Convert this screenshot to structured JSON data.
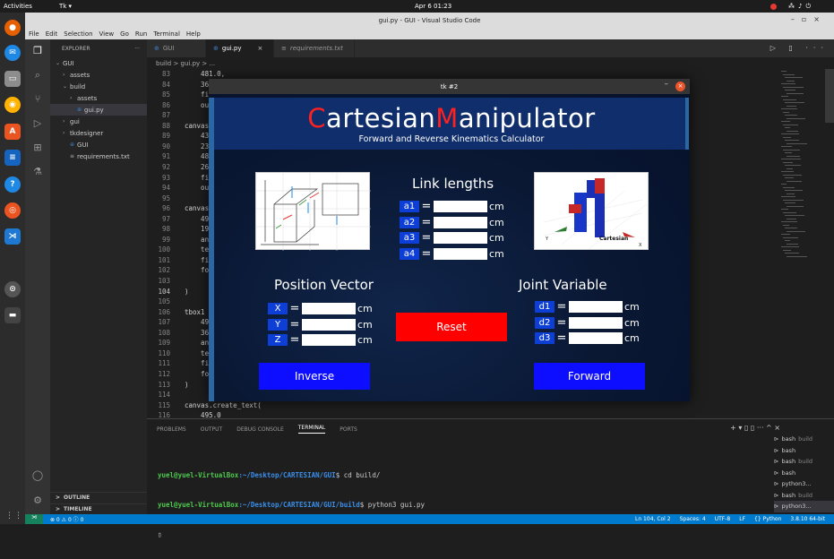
{
  "topbar": {
    "activities": "Activities",
    "app": "Tk ▾",
    "clock": "Apr 6  01:23"
  },
  "vscode": {
    "title": "gui.py - GUI - Visual Studio Code",
    "menu": [
      "File",
      "Edit",
      "Selection",
      "View",
      "Go",
      "Run",
      "Terminal",
      "Help"
    ],
    "explorer": {
      "header": "EXPLORER",
      "more": "···",
      "items": [
        {
          "label": "GUI",
          "arrow": "v",
          "indent": 0
        },
        {
          "label": "assets",
          "arrow": ">",
          "indent": 1
        },
        {
          "label": "build",
          "arrow": "v",
          "indent": 1
        },
        {
          "label": "assets",
          "arrow": ">",
          "indent": 2
        },
        {
          "label": "gui.py",
          "arrow": "",
          "indent": 2,
          "selected": true,
          "py": true
        },
        {
          "label": "gui",
          "arrow": ">",
          "indent": 1
        },
        {
          "label": "tkdesigner",
          "arrow": ">",
          "indent": 1
        },
        {
          "label": "GUI",
          "arrow": "",
          "indent": 1,
          "py": true
        },
        {
          "label": "requirements.txt",
          "arrow": "",
          "indent": 1,
          "txt": true
        }
      ],
      "outline": "OUTLINE",
      "timeline": "TIMELINE"
    },
    "tabs": [
      {
        "label": "GUI",
        "active": false
      },
      {
        "label": "gui.py",
        "active": true,
        "close": "×"
      },
      {
        "label": "requirements.txt",
        "active": false
      }
    ],
    "tab_actions": "▷ ▯ ···",
    "breadcrumb": "build > gui.py > ...",
    "code": [
      {
        "n": "83",
        "t": "    481.0,"
      },
      {
        "n": "84",
        "t": "    36"
      },
      {
        "n": "85",
        "t": "    fi"
      },
      {
        "n": "86",
        "t": "    ou"
      },
      {
        "n": "87",
        "t": ""
      },
      {
        "n": "88",
        "t": "canvas"
      },
      {
        "n": "89",
        "t": "    43"
      },
      {
        "n": "90",
        "t": "    23"
      },
      {
        "n": "91",
        "t": "    48"
      },
      {
        "n": "92",
        "t": "    26"
      },
      {
        "n": "93",
        "t": "    fi"
      },
      {
        "n": "94",
        "t": "    ou"
      },
      {
        "n": "95",
        "t": ""
      },
      {
        "n": "96",
        "t": "canvas"
      },
      {
        "n": "97",
        "t": "    49"
      },
      {
        "n": "98",
        "t": "    19"
      },
      {
        "n": "99",
        "t": "    an"
      },
      {
        "n": "100",
        "t": "    te"
      },
      {
        "n": "101",
        "t": "    fi"
      },
      {
        "n": "102",
        "t": "    fo"
      },
      {
        "n": "103",
        "t": ""
      },
      {
        "n": "104",
        "t": ")"
      },
      {
        "n": "105",
        "t": ""
      },
      {
        "n": "106",
        "t": "tbox1"
      },
      {
        "n": "107",
        "t": "    49"
      },
      {
        "n": "108",
        "t": "    36"
      },
      {
        "n": "109",
        "t": "    an"
      },
      {
        "n": "110",
        "t": "    te"
      },
      {
        "n": "111",
        "t": "    fi"
      },
      {
        "n": "112",
        "t": "    fo"
      },
      {
        "n": "113",
        "t": ")"
      },
      {
        "n": "114",
        "t": ""
      },
      {
        "n": "115",
        "t": "canvas.create_text("
      },
      {
        "n": "116",
        "t": "    495.0"
      }
    ],
    "current_line": "104",
    "panel_tabs": [
      "PROBLEMS",
      "OUTPUT",
      "DEBUG CONSOLE",
      "TERMINAL",
      "PORTS"
    ],
    "panel_active": "TERMINAL",
    "panel_actions": "+ ▾ ▯ ▯ ··· ^ ×",
    "terminal": [
      {
        "user": "yuel@yuel-VirtualBox",
        "path": ":~/Desktop/CARTESIAN/GUI",
        "cmd": "$ cd build/"
      },
      {
        "user": "yuel@yuel-VirtualBox",
        "path": ":~/Desktop/CARTESIAN/GUI/build",
        "cmd": "$ python3 gui.py"
      }
    ],
    "term_list": [
      {
        "name": "bash",
        "sub": "build"
      },
      {
        "name": "bash",
        "sub": ""
      },
      {
        "name": "bash",
        "sub": "build"
      },
      {
        "name": "bash",
        "sub": ""
      },
      {
        "name": "python3...",
        "sub": ""
      },
      {
        "name": "bash",
        "sub": "build"
      },
      {
        "name": "python3...",
        "sub": "",
        "active": true
      }
    ],
    "status": {
      "problems": "⊗ 0 ⚠ 0   ⓘ 0",
      "position": "Ln 104, Col 2",
      "spaces": "Spaces: 4",
      "encoding": "UTF-8",
      "eol": "LF",
      "lang": "{} Python",
      "interp": "3.8.10 64-bit"
    }
  },
  "tk": {
    "window_title": "tk #2",
    "brand": {
      "c1": "C",
      "p1": "artesian",
      "c2": "M",
      "p2": "anipulator"
    },
    "subtitle": "Forward and Reverse Kinematics Calculator",
    "link_heading": "Link lengths",
    "links": [
      {
        "label": "a1",
        "unit": "cm"
      },
      {
        "label": "a2",
        "unit": "cm"
      },
      {
        "label": "a3",
        "unit": "cm"
      },
      {
        "label": "a4",
        "unit": "cm"
      }
    ],
    "position_heading": "Position Vector",
    "position": [
      {
        "label": "X",
        "unit": "cm"
      },
      {
        "label": "Y",
        "unit": "cm"
      },
      {
        "label": "Z",
        "unit": "cm"
      }
    ],
    "joint_heading": "Joint Variable",
    "joints": [
      {
        "label": "d1",
        "unit": "cm"
      },
      {
        "label": "d2",
        "unit": "cm"
      },
      {
        "label": "d3",
        "unit": "cm"
      }
    ],
    "eq": "=",
    "reset": "Reset",
    "inverse": "Inverse",
    "forward": "Forward",
    "robot_caption": "Cartesian",
    "colors": {
      "reset": "#ff0000",
      "action": "#0d0dff",
      "label": "#0d3fd6",
      "header": "#0f2e6b"
    }
  }
}
